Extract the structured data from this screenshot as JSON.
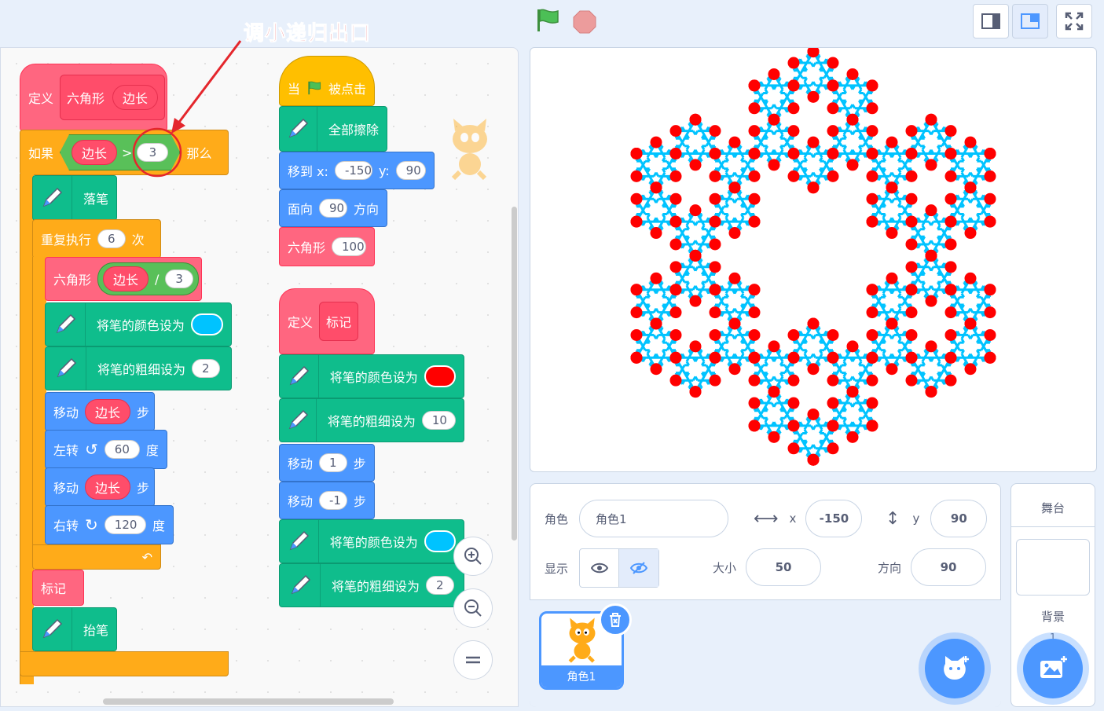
{
  "annotation": "调小递归出口",
  "code": {
    "define1": {
      "label": "定义",
      "name": "六角形",
      "param": "边长"
    },
    "if": {
      "label": "如果",
      "param": "边长",
      "op": ">",
      "value": "3",
      "then": "那么"
    },
    "pen_down": "落笔",
    "repeat": {
      "label": "重复执行",
      "count": "6",
      "suffix": "次"
    },
    "call_hex": {
      "label": "六角形",
      "param": "边长",
      "op": "/",
      "value": "3"
    },
    "set_color1": "将笔的颜色设为",
    "set_size1": {
      "label": "将笔的粗细设为",
      "value": "2"
    },
    "move1": {
      "label": "移动",
      "param": "边长",
      "suffix": "步"
    },
    "turn_left": {
      "label": "左转",
      "value": "60",
      "suffix": "度"
    },
    "move2": {
      "label": "移动",
      "param": "边长",
      "suffix": "步"
    },
    "turn_right": {
      "label": "右转",
      "value": "120",
      "suffix": "度"
    },
    "mark_call": "标记",
    "pen_up": "抬笔",
    "when_flag": {
      "label1": "当",
      "label2": "被点击"
    },
    "clear": "全部擦除",
    "goto": {
      "label": "移到 x:",
      "x": "-150",
      "ylabel": "y:",
      "y": "90"
    },
    "point": {
      "label": "面向",
      "value": "90",
      "suffix": "方向"
    },
    "hex_call": {
      "label": "六角形",
      "value": "100"
    },
    "define2": {
      "label": "定义",
      "name": "标记"
    },
    "set_color2": "将笔的颜色设为",
    "set_size2": {
      "label": "将笔的粗细设为",
      "value": "10"
    },
    "move3": {
      "label": "移动",
      "value": "1",
      "suffix": "步"
    },
    "move4": {
      "label": "移动",
      "value": "-1",
      "suffix": "步"
    },
    "set_color3": "将笔的颜色设为",
    "set_size3": {
      "label": "将笔的粗细设为",
      "value": "2"
    }
  },
  "colors": {
    "cyan": "#00c3ff",
    "red": "#ff0000"
  },
  "sprite": {
    "label": "角色",
    "name": "角色1",
    "x_label": "x",
    "x": "-150",
    "y_label": "y",
    "y": "90",
    "show_label": "显示",
    "size_label": "大小",
    "size": "50",
    "direction_label": "方向",
    "direction": "90",
    "thumb_name": "角色1"
  },
  "stage_pane": {
    "title": "舞台",
    "backdrop_label": "背景",
    "backdrop_count": "1"
  },
  "icons": [
    "green-flag-icon",
    "stop-icon",
    "small-stage-icon",
    "normal-stage-icon",
    "fullscreen-icon",
    "zoom-in-icon",
    "zoom-out-icon",
    "zoom-reset-icon",
    "eye-icon",
    "eye-slash-icon",
    "delete-icon",
    "choose-sprite-icon",
    "choose-backdrop-icon"
  ]
}
